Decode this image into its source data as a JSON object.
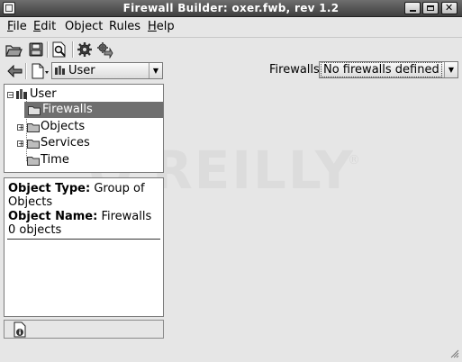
{
  "window": {
    "title": "Firewall Builder: oxer.fwb, rev 1.2"
  },
  "menubar": {
    "items": [
      {
        "label": "File",
        "mnemonic": "F",
        "rest": "ile"
      },
      {
        "label": "Edit",
        "mnemonic": "E",
        "rest": "dit"
      },
      {
        "label": "Object",
        "mnemonic": "",
        "rest": "Object"
      },
      {
        "label": "Rules",
        "mnemonic": "",
        "rest": "Rules"
      },
      {
        "label": "Help",
        "mnemonic": "H",
        "rest": "elp"
      }
    ]
  },
  "toolbar": {
    "buttons": [
      "open-icon",
      "save-icon",
      "find-icon",
      "compile-icon",
      "install-icon"
    ]
  },
  "library": {
    "selected": "User"
  },
  "firewalls": {
    "label": "Firewalls:",
    "selected": "No firewalls defined"
  },
  "tree": {
    "root": "User",
    "items": [
      {
        "label": "Firewalls",
        "selected": true,
        "expandable": false
      },
      {
        "label": "Objects",
        "selected": false,
        "expandable": true
      },
      {
        "label": "Services",
        "selected": false,
        "expandable": true
      },
      {
        "label": "Time",
        "selected": false,
        "expandable": false
      }
    ]
  },
  "info": {
    "type_label": "Object Type:",
    "type_value": "Group of Objects",
    "name_label": "Object Name:",
    "name_value": "Firewalls",
    "count": "0 objects"
  },
  "watermark": {
    "text": "O'REILLY",
    "mark": "®"
  },
  "colors": {
    "titlebar": "#4f4f4f",
    "selection": "#6f6f6f",
    "background": "#e6e6e6"
  }
}
